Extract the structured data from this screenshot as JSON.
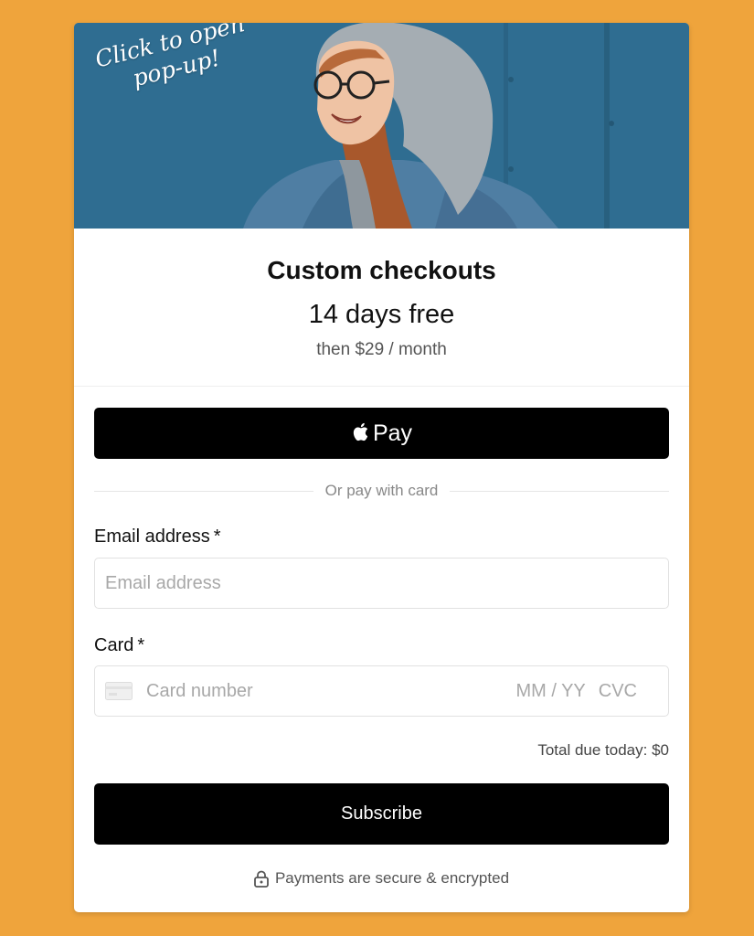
{
  "hero": {
    "caption": "Click to open pop-up!",
    "image": "smiling-woman-in-hoodie-photo"
  },
  "product": {
    "title": "Custom checkouts",
    "trial": "14 days free",
    "interval": "then $29 / month"
  },
  "apple_pay": {
    "icon": "apple-logo-icon",
    "label": "Pay"
  },
  "divider_text": "Or pay with card",
  "email": {
    "label": "Email address",
    "required_mark": "*",
    "placeholder": "Email address",
    "value": ""
  },
  "card": {
    "label": "Card",
    "required_mark": "*",
    "icon": "credit-card-icon",
    "number_placeholder": "Card number",
    "expiry_placeholder": "MM / YY",
    "cvc_placeholder": "CVC"
  },
  "total": "Total due today: $0",
  "subscribe_label": "Subscribe",
  "secure_text": "Payments are secure & encrypted",
  "colors": {
    "page_background": "#efa43c",
    "card_background": "#ffffff",
    "button": "#000000",
    "hero_background": "#2f6b8f"
  }
}
